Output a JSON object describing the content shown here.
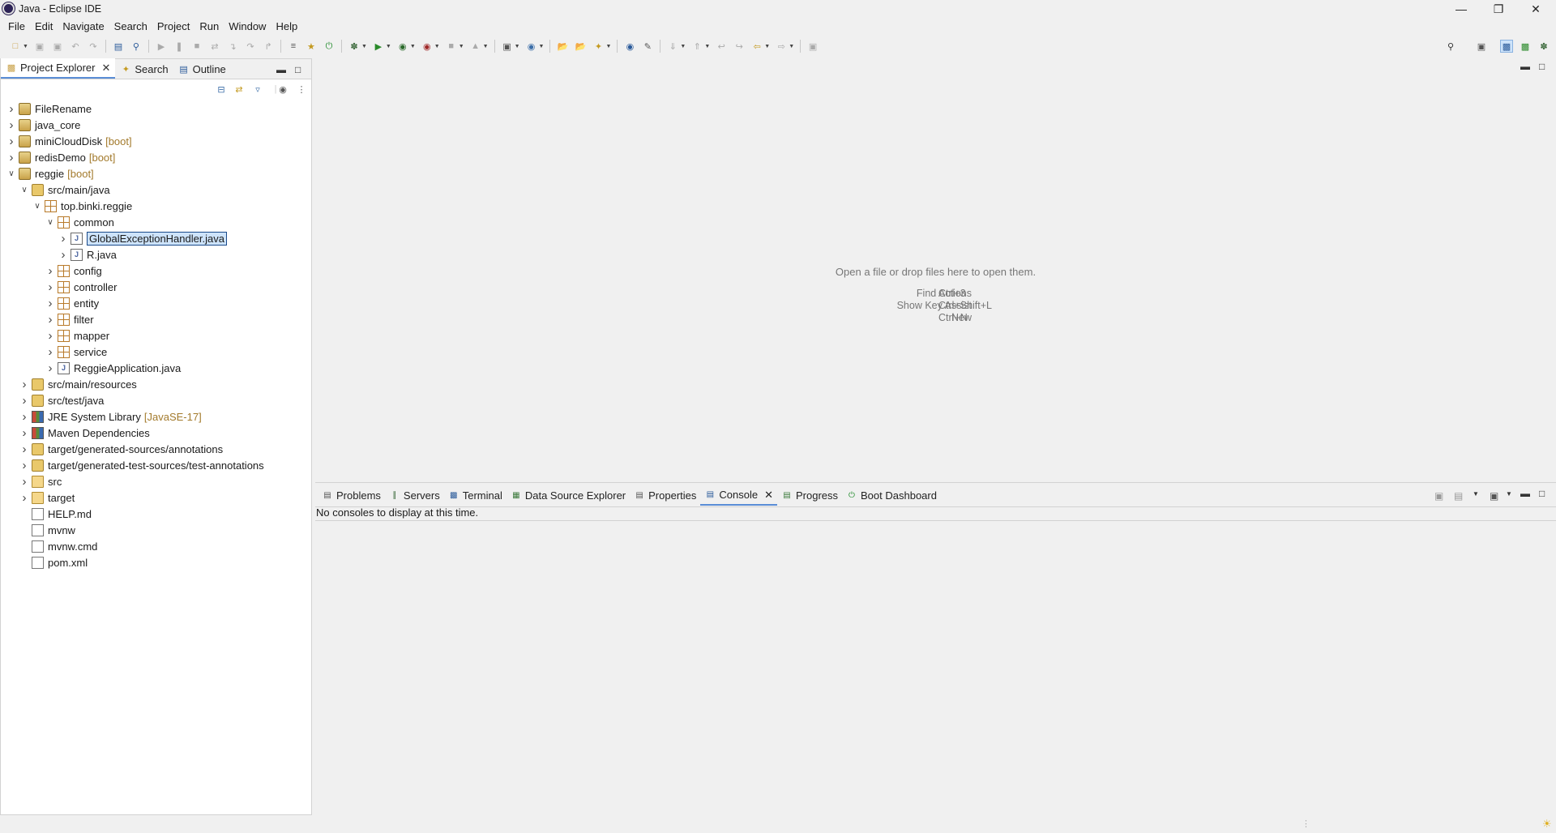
{
  "window": {
    "title": "Java - Eclipse IDE"
  },
  "menu": [
    "File",
    "Edit",
    "Navigate",
    "Search",
    "Project",
    "Run",
    "Window",
    "Help"
  ],
  "left_panel": {
    "tabs": [
      {
        "label": "Project Explorer",
        "active": true
      },
      {
        "label": "Search",
        "active": false
      },
      {
        "label": "Outline",
        "active": false
      }
    ],
    "tree": [
      {
        "label": "FileRename",
        "level": 0,
        "expanded": false,
        "icon": "project-icon"
      },
      {
        "label": "java_core",
        "level": 0,
        "expanded": false,
        "icon": "project-icon"
      },
      {
        "label": "miniCloudDisk",
        "deco": "[boot]",
        "level": 0,
        "expanded": false,
        "icon": "project-icon"
      },
      {
        "label": "redisDemo",
        "deco": "[boot]",
        "level": 0,
        "expanded": false,
        "icon": "project-icon"
      },
      {
        "label": "reggie",
        "deco": "[boot]",
        "level": 0,
        "expanded": true,
        "icon": "project-icon"
      },
      {
        "label": "src/main/java",
        "level": 1,
        "expanded": true,
        "icon": "source-folder-icon"
      },
      {
        "label": "top.binki.reggie",
        "level": 2,
        "expanded": true,
        "icon": "package-icon"
      },
      {
        "label": "common",
        "level": 3,
        "expanded": true,
        "icon": "package-icon"
      },
      {
        "label": "GlobalExceptionHandler.java",
        "level": 4,
        "expanded": false,
        "icon": "java-file-icon",
        "selected": true
      },
      {
        "label": "R.java",
        "level": 4,
        "expanded": false,
        "icon": "java-file-icon"
      },
      {
        "label": "config",
        "level": 3,
        "expanded": false,
        "icon": "package-icon"
      },
      {
        "label": "controller",
        "level": 3,
        "expanded": false,
        "icon": "package-icon"
      },
      {
        "label": "entity",
        "level": 3,
        "expanded": false,
        "icon": "package-icon"
      },
      {
        "label": "filter",
        "level": 3,
        "expanded": false,
        "icon": "package-icon"
      },
      {
        "label": "mapper",
        "level": 3,
        "expanded": false,
        "icon": "package-icon"
      },
      {
        "label": "service",
        "level": 3,
        "expanded": false,
        "icon": "package-icon"
      },
      {
        "label": "ReggieApplication.java",
        "level": 3,
        "expanded": false,
        "icon": "java-file-icon"
      },
      {
        "label": "src/main/resources",
        "level": 1,
        "expanded": false,
        "icon": "source-folder-icon"
      },
      {
        "label": "src/test/java",
        "level": 1,
        "expanded": false,
        "icon": "source-folder-icon"
      },
      {
        "label": "JRE System Library",
        "deco": "[JavaSE-17]",
        "level": 1,
        "expanded": false,
        "icon": "library-icon"
      },
      {
        "label": "Maven Dependencies",
        "level": 1,
        "expanded": false,
        "icon": "library-icon"
      },
      {
        "label": "target/generated-sources/annotations",
        "level": 1,
        "expanded": false,
        "icon": "source-folder-icon"
      },
      {
        "label": "target/generated-test-sources/test-annotations",
        "level": 1,
        "expanded": false,
        "icon": "source-folder-icon"
      },
      {
        "label": "src",
        "level": 1,
        "expanded": false,
        "icon": "folder-icon"
      },
      {
        "label": "target",
        "level": 1,
        "expanded": false,
        "icon": "folder-icon"
      },
      {
        "label": "HELP.md",
        "level": 1,
        "leaf": true,
        "icon": "file-icon"
      },
      {
        "label": "mvnw",
        "level": 1,
        "leaf": true,
        "icon": "file-icon"
      },
      {
        "label": "mvnw.cmd",
        "level": 1,
        "leaf": true,
        "icon": "file-icon"
      },
      {
        "label": "pom.xml",
        "level": 1,
        "leaf": true,
        "icon": "xml-file-icon"
      }
    ]
  },
  "editor": {
    "hint": "Open a file or drop files here to open them.",
    "shortcuts": [
      {
        "action": "Find Actions",
        "keys": "Ctrl+3"
      },
      {
        "action": "Show Key Assist",
        "keys": "Ctrl+Shift+L"
      },
      {
        "action": "New",
        "keys": "Ctrl+N"
      }
    ]
  },
  "bottom_panel": {
    "tabs": [
      {
        "label": "Problems",
        "icon": "problems-icon"
      },
      {
        "label": "Servers",
        "icon": "servers-icon"
      },
      {
        "label": "Terminal",
        "icon": "terminal-icon"
      },
      {
        "label": "Data Source Explorer",
        "icon": "data-source-icon"
      },
      {
        "label": "Properties",
        "icon": "properties-icon"
      },
      {
        "label": "Console",
        "icon": "console-icon",
        "active": true
      },
      {
        "label": "Progress",
        "icon": "progress-icon"
      },
      {
        "label": "Boot Dashboard",
        "icon": "boot-dashboard-icon"
      }
    ],
    "message": "No consoles to display at this time."
  }
}
